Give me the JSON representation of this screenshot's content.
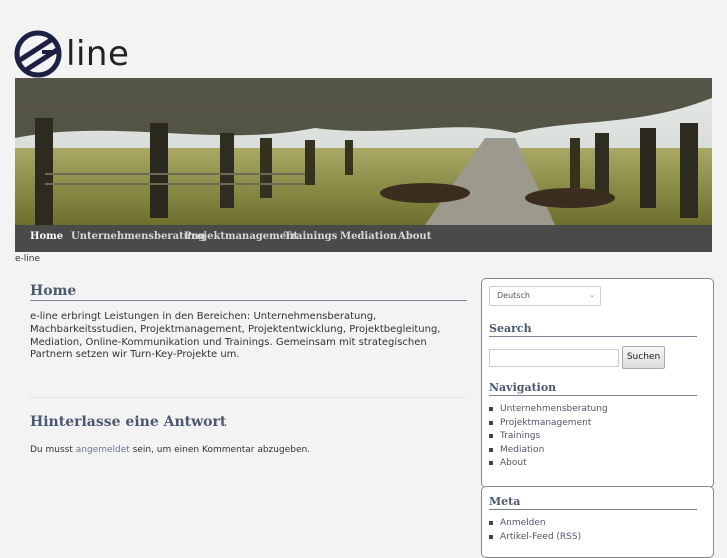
{
  "logo": {
    "text": "line"
  },
  "nav": {
    "items": [
      "Home",
      "Unternehmensberatung",
      "Projektmanagement",
      "Trainings",
      "Mediation",
      "About"
    ]
  },
  "breadcrumb": "e-line",
  "main": {
    "title": "Home",
    "text": "e-line erbringt Leistungen in den Bereichen: Unternehmensberatung, Machbarkeitsstudien, Projektmanagement, Projektentwicklung, Projektbegleitung, Mediation, Online-Kommunikation und Trainings. Gemeinsam mit strategischen Partnern setzen wir Turn-Key-Projekte um."
  },
  "reply": {
    "title": "Hinterlasse eine Antwort",
    "text_before": "Du musst ",
    "link": "angemeldet",
    "text_after": " sein, um einen Kommentar abzugeben."
  },
  "sidebar": {
    "language": "Deutsch",
    "search_title": "Search",
    "search_button": "Suchen",
    "navigation_title": "Navigation",
    "navigation_items": [
      "Unternehmensberatung",
      "Projektmanagement",
      "Trainings",
      "Mediation",
      "About"
    ],
    "meta_title": "Meta",
    "meta_items": [
      "Anmelden",
      "Artikel-Feed (RSS)"
    ]
  }
}
